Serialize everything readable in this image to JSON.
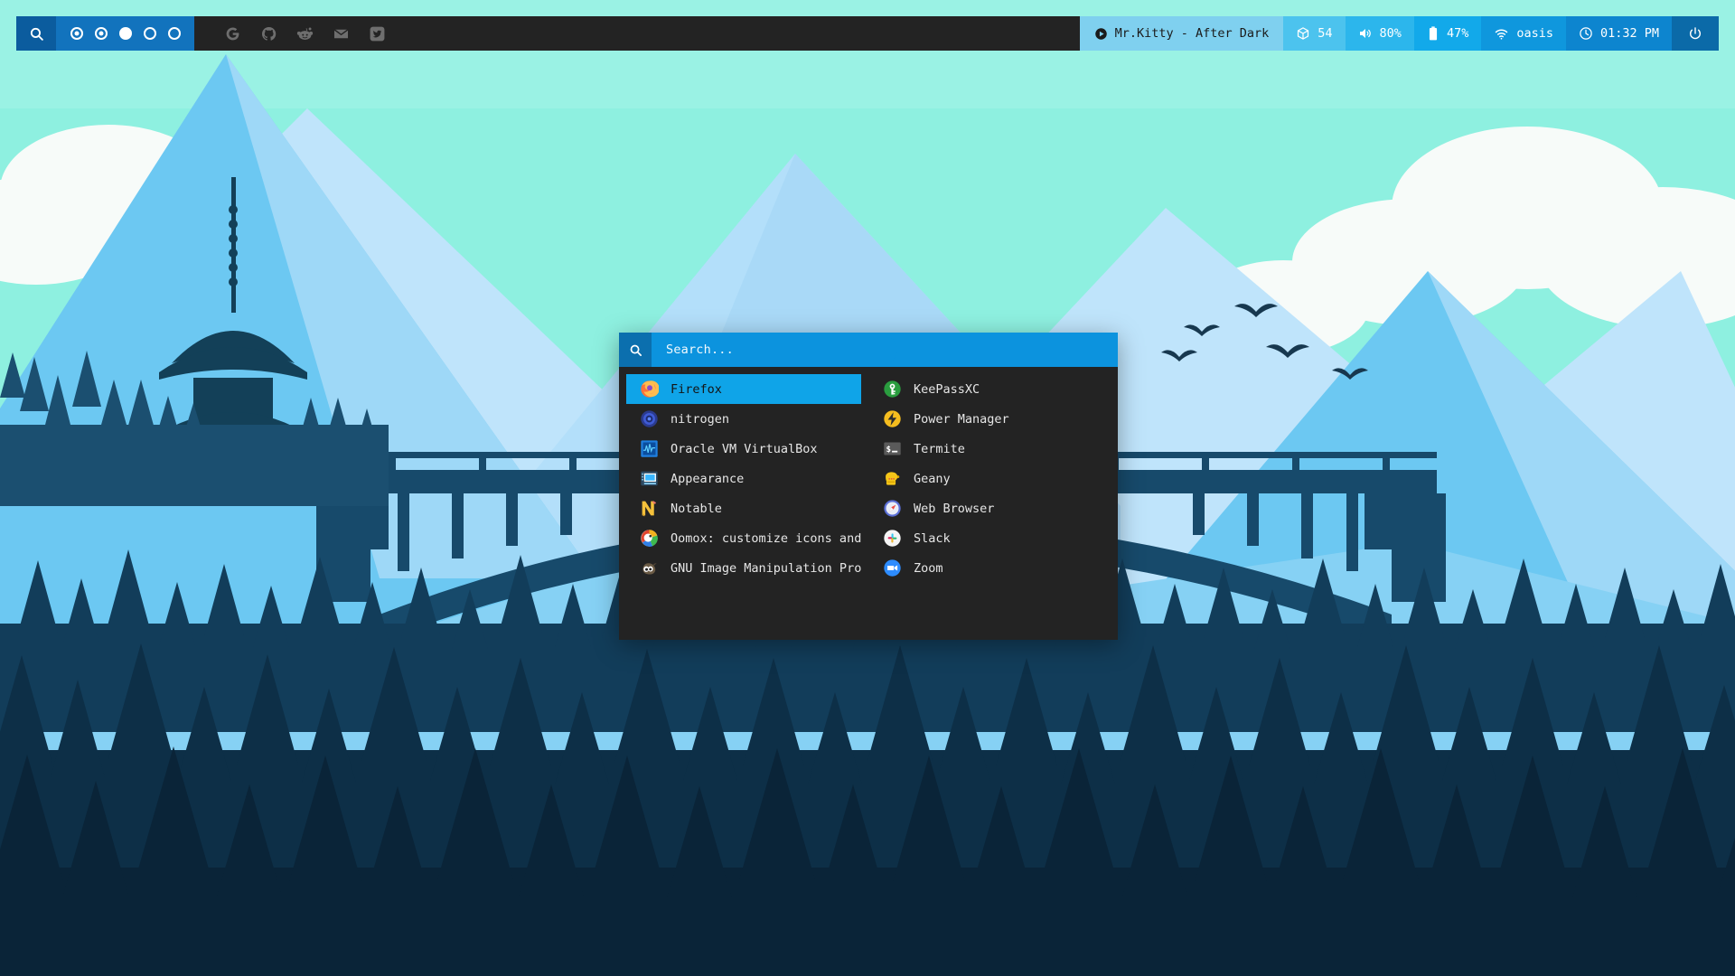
{
  "bar": {
    "search_button": {
      "name": "search",
      "icon": "search-icon"
    },
    "workspaces": [
      {
        "label": "1",
        "state": "occupied"
      },
      {
        "label": "2",
        "state": "occupied"
      },
      {
        "label": "3",
        "state": "active"
      },
      {
        "label": "4",
        "state": "empty"
      },
      {
        "label": "5",
        "state": "empty"
      }
    ],
    "links": [
      {
        "name": "google",
        "icon": "google-icon",
        "label": "Google"
      },
      {
        "name": "github",
        "icon": "github-icon",
        "label": "GitHub"
      },
      {
        "name": "reddit",
        "icon": "reddit-icon",
        "label": "Reddit"
      },
      {
        "name": "mail",
        "icon": "mail-icon",
        "label": "Mail"
      },
      {
        "name": "twitter",
        "icon": "twitter-icon",
        "label": "Twitter"
      }
    ],
    "modules": {
      "music": {
        "icon": "play-icon",
        "text": "Mr.Kitty - After Dark",
        "color": "#7fd0ef"
      },
      "packages": {
        "icon": "package-icon",
        "text": "54",
        "color": "#4cc3ee"
      },
      "volume": {
        "icon": "volume-icon",
        "text": "80%",
        "color": "#2cb6ec"
      },
      "battery": {
        "icon": "battery-icon",
        "text": "47%",
        "color": "#12a9ea"
      },
      "network": {
        "icon": "wifi-icon",
        "text": "oasis",
        "color": "#0f97dd"
      },
      "clock": {
        "icon": "clock-icon",
        "text": "01:32 PM",
        "color": "#0d85cf"
      },
      "power": {
        "icon": "power-icon",
        "label": "Power",
        "color": "#0b6aa8"
      }
    }
  },
  "launcher": {
    "search": {
      "placeholder": "Search...",
      "value": ""
    },
    "columns": [
      {
        "items": [
          {
            "label": "Firefox",
            "icon": "firefox-icon",
            "selected": true
          },
          {
            "label": "nitrogen",
            "icon": "nitrogen-icon",
            "selected": false
          },
          {
            "label": "Oracle VM VirtualBox",
            "icon": "virtualbox-icon",
            "selected": false
          },
          {
            "label": "Appearance",
            "icon": "appearance-icon",
            "selected": false
          },
          {
            "label": "Notable",
            "icon": "notable-icon",
            "selected": false
          },
          {
            "label": "Oomox: customize icons and GTK…",
            "icon": "oomox-icon",
            "selected": false
          },
          {
            "label": "GNU Image Manipulation Program",
            "icon": "gimp-icon",
            "selected": false
          }
        ]
      },
      {
        "items": [
          {
            "label": "KeePassXC",
            "icon": "keepassxc-icon",
            "selected": false
          },
          {
            "label": "Power Manager",
            "icon": "power-manager-icon",
            "selected": false
          },
          {
            "label": "Termite",
            "icon": "terminal-icon",
            "selected": false
          },
          {
            "label": "Geany",
            "icon": "geany-icon",
            "selected": false
          },
          {
            "label": "Web Browser",
            "icon": "compass-icon",
            "selected": false
          },
          {
            "label": "Slack",
            "icon": "slack-icon",
            "selected": false
          },
          {
            "label": "Zoom",
            "icon": "zoom-icon",
            "selected": false
          }
        ]
      }
    ]
  },
  "theme": {
    "accent": "#0fa4e8",
    "bar_bg": "#232323",
    "launcher_bg": "#232323",
    "sky": "#8ef0e0"
  }
}
